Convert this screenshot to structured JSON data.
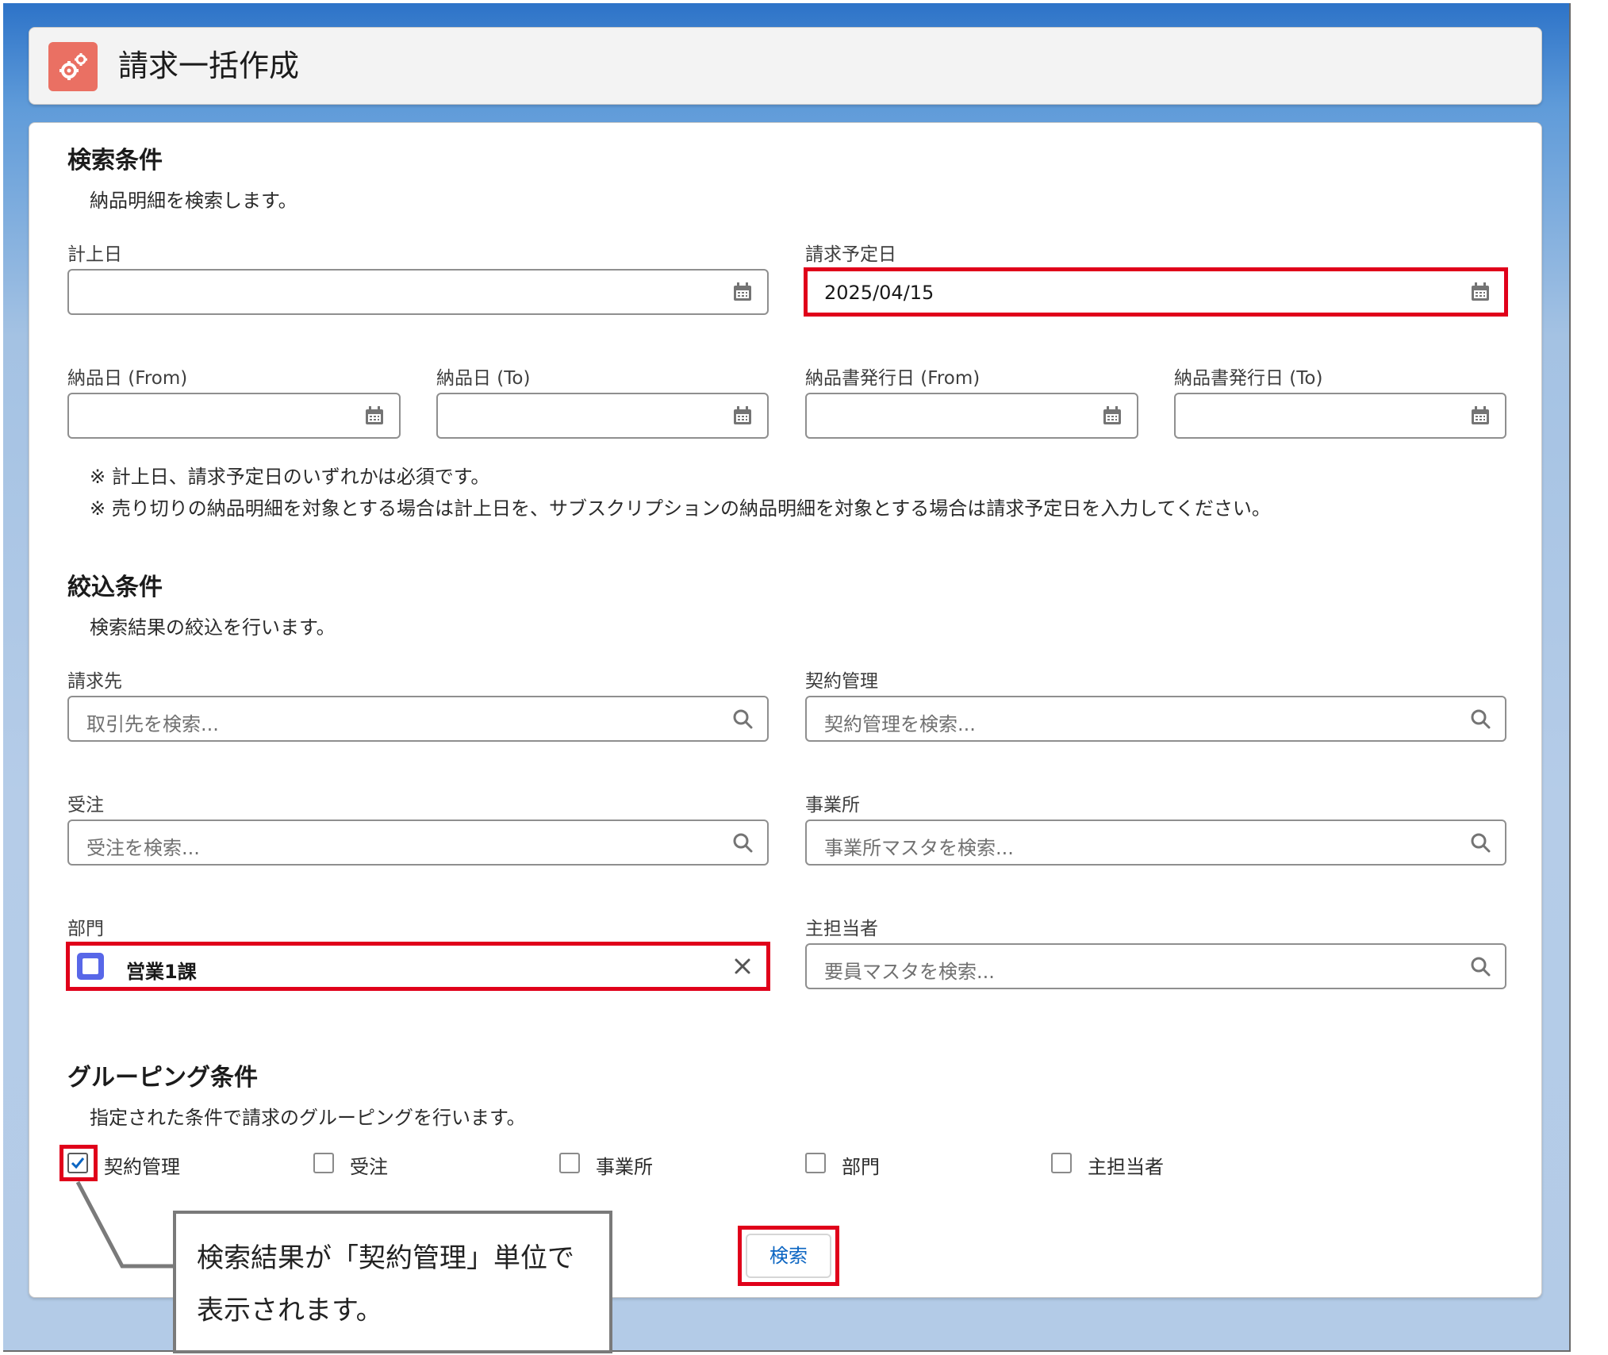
{
  "header": {
    "title": "請求一括作成",
    "icon": "gears-icon"
  },
  "search_section": {
    "title": "検索条件",
    "description": "納品明細を検索します。",
    "fields": [
      {
        "label": "計上日",
        "value": "",
        "icon": "calendar-icon"
      },
      {
        "label": "請求予定日",
        "value": "2025/04/15",
        "icon": "calendar-icon"
      },
      {
        "label": "納品日 (From)",
        "value": "",
        "icon": "calendar-icon"
      },
      {
        "label": "納品日 (To)",
        "value": "",
        "icon": "calendar-icon"
      },
      {
        "label": "納品書発行日 (From)",
        "value": "",
        "icon": "calendar-icon"
      },
      {
        "label": "納品書発行日 (To)",
        "value": "",
        "icon": "calendar-icon"
      }
    ],
    "notes": [
      "※ 計上日、請求予定日のいずれかは必須です。",
      "※ 売り切りの納品明細を対象とする場合は計上日を、サブスクリプションの納品明細を対象とする場合は請求予定日を入力してください。"
    ]
  },
  "filter_section": {
    "title": "絞込条件",
    "description": "検索結果の絞込を行います。",
    "fields": [
      {
        "label": "請求先",
        "placeholder": "取引先を検索..."
      },
      {
        "label": "契約管理",
        "placeholder": "契約管理を検索..."
      },
      {
        "label": "受注",
        "placeholder": "受注を検索..."
      },
      {
        "label": "事業所",
        "placeholder": "事業所マスタを検索..."
      },
      {
        "label": "部門",
        "selected": "営業1課"
      },
      {
        "label": "主担当者",
        "placeholder": "要員マスタを検索..."
      }
    ]
  },
  "grouping_section": {
    "title": "グルーピング条件",
    "description": "指定された条件で請求のグルーピングを行います。",
    "options": [
      {
        "label": "契約管理",
        "checked": true
      },
      {
        "label": "受注",
        "checked": false
      },
      {
        "label": "事業所",
        "checked": false
      },
      {
        "label": "部門",
        "checked": false
      },
      {
        "label": "主担当者",
        "checked": false
      }
    ]
  },
  "actions": {
    "search_label": "検索"
  },
  "callout": {
    "lines": [
      "検索結果が「契約管理」単位で",
      "表示されます。"
    ]
  },
  "colors": {
    "highlight": "#e0001a",
    "accent": "#0b65c2",
    "header_icon": "#ea7063",
    "pill_icon": "#5867e8"
  }
}
